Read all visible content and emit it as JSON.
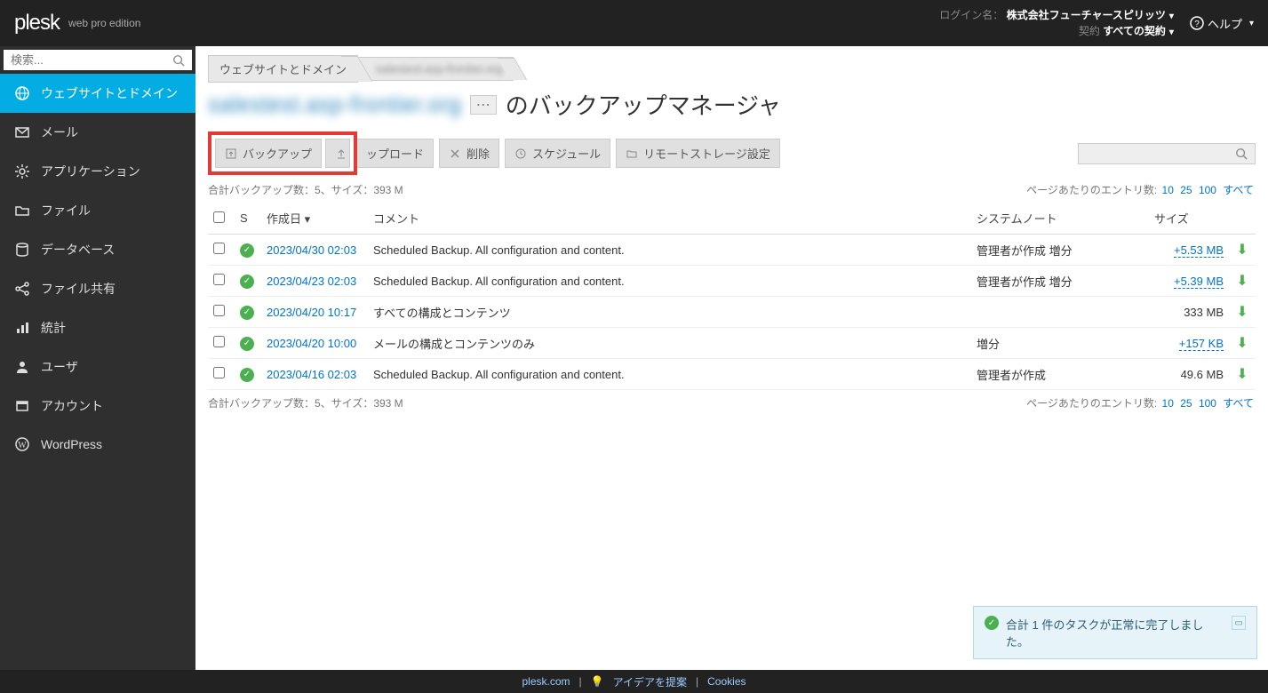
{
  "header": {
    "logo": "plesk",
    "edition": "web pro edition",
    "login_label": "ログイン名：",
    "login_name": "株式会社フューチャースピリッツ",
    "contract_label": "契約",
    "contract_value": "すべての契約",
    "help": "ヘルプ"
  },
  "sidebar": {
    "search_placeholder": "検索...",
    "items": [
      {
        "label": "ウェブサイトとドメイン"
      },
      {
        "label": "メール"
      },
      {
        "label": "アプリケーション"
      },
      {
        "label": "ファイル"
      },
      {
        "label": "データベース"
      },
      {
        "label": "ファイル共有"
      },
      {
        "label": "統計"
      },
      {
        "label": "ユーザ"
      },
      {
        "label": "アカウント"
      },
      {
        "label": "WordPress"
      }
    ]
  },
  "breadcrumb": {
    "item0": "ウェブサイトとドメイン",
    "item1_blurred": "salestest.asp-frontier.org"
  },
  "page": {
    "domain_blurred": "salestest.asp-frontier.org",
    "title_suffix": "のバックアップマネージャ"
  },
  "toolbar": {
    "backup": "バックアップ",
    "upload": "ップロード",
    "delete": "削除",
    "schedule": "スケジュール",
    "remote": "リモートストレージ設定"
  },
  "summary": {
    "text": "合計バックアップ数：5、サイズ：393 M",
    "pager_label": "ページあたりのエントリ数:",
    "p10": "10",
    "p25": "25",
    "p100": "100",
    "pall": "すべて"
  },
  "table": {
    "headers": {
      "status": "S",
      "date": "作成日",
      "comment": "コメント",
      "sysnote": "システムノート",
      "size": "サイズ"
    },
    "rows": [
      {
        "date": "2023/04/30 02:03",
        "comment": "Scheduled Backup. All configuration and content.",
        "sysnote": "管理者が作成 増分",
        "size": "+5.53 MB",
        "size_link": true
      },
      {
        "date": "2023/04/23 02:03",
        "comment": "Scheduled Backup. All configuration and content.",
        "sysnote": "管理者が作成 増分",
        "size": "+5.39 MB",
        "size_link": true
      },
      {
        "date": "2023/04/20 10:17",
        "comment": "すべての構成とコンテンツ",
        "sysnote": "",
        "size": "333 MB",
        "size_link": false
      },
      {
        "date": "2023/04/20 10:00",
        "comment": "メールの構成とコンテンツのみ",
        "sysnote": "増分",
        "size": "+157 KB",
        "size_link": true
      },
      {
        "date": "2023/04/16 02:03",
        "comment": "Scheduled Backup. All configuration and content.",
        "sysnote": "管理者が作成",
        "size": "49.6 MB",
        "size_link": false
      }
    ]
  },
  "toast": {
    "message": "合計 1 件のタスクが正常に完了しました。"
  },
  "footer": {
    "plesk": "plesk.com",
    "idea": "アイデアを提案",
    "cookies": "Cookies"
  }
}
